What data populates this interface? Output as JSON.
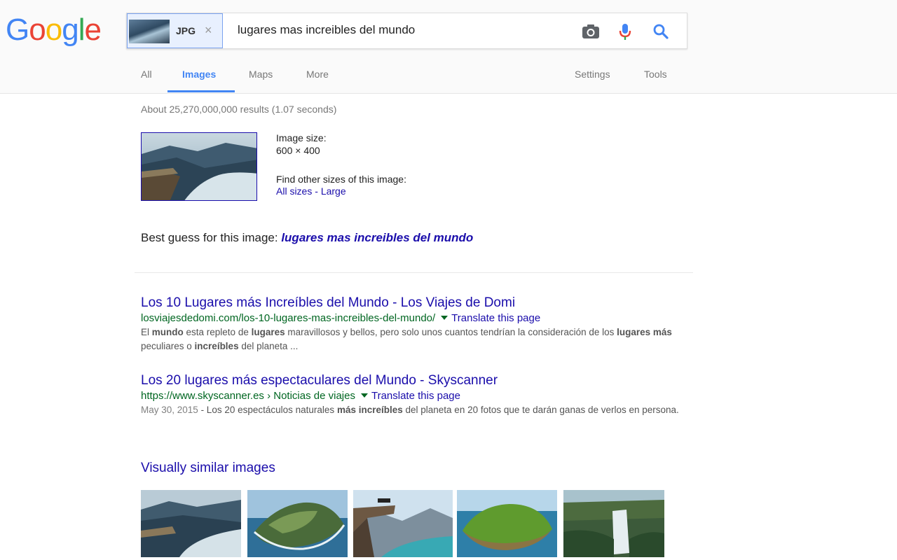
{
  "logo": {
    "text": "Google"
  },
  "search": {
    "chip_label": "JPG",
    "chip_close": "×",
    "query": "lugares mas increibles del mundo"
  },
  "tabs": [
    {
      "label": "All"
    },
    {
      "label": "Images",
      "active": true
    },
    {
      "label": "Maps"
    },
    {
      "label": "More"
    }
  ],
  "tools": [
    {
      "label": "Settings"
    },
    {
      "label": "Tools"
    }
  ],
  "stats": "About 25,270,000,000 results (1.07 seconds)",
  "image_info": {
    "size_label": "Image size:",
    "size_value": "600 × 400",
    "find_label": "Find other sizes of this image:",
    "all_sizes": "All sizes",
    "separator": " - ",
    "large": "Large"
  },
  "best_guess": {
    "label": "Best guess for this image: ",
    "value": "lugares mas increibles del mundo"
  },
  "results": [
    {
      "title": "Los 10 Lugares más Increíbles del Mundo - Los Viajes de Domi",
      "url": "losviajesdedomi.com/los-10-lugares-mas-increibles-del-mundo/",
      "translate": "Translate this page",
      "snippet_parts": [
        {
          "t": "El ",
          "b": false
        },
        {
          "t": "mundo",
          "b": true
        },
        {
          "t": " esta repleto de ",
          "b": false
        },
        {
          "t": "lugares",
          "b": true
        },
        {
          "t": " maravillosos y bellos, pero solo unos cuantos tendrían la consideración de los ",
          "b": false
        },
        {
          "t": "lugares más",
          "b": true
        },
        {
          "t": " peculiares o ",
          "b": false
        },
        {
          "t": "increíbles",
          "b": true
        },
        {
          "t": " del planeta ...",
          "b": false
        }
      ]
    },
    {
      "title": "Los 20 lugares más espectaculares del Mundo - Skyscanner",
      "url": "https://www.skyscanner.es › Noticias de viajes",
      "translate": "Translate this page",
      "date": "May 30, 2015",
      "snippet_parts": [
        {
          "t": " - Los 20 espectáculos naturales ",
          "b": false
        },
        {
          "t": "más increíbles",
          "b": true
        },
        {
          "t": " del planeta en 20 fotos que te darán ganas de verlos en persona.",
          "b": false
        }
      ]
    }
  ],
  "similar": {
    "title": "Visually similar images",
    "images": [
      {
        "name": "fjord-cliff"
      },
      {
        "name": "green-island-coast"
      },
      {
        "name": "rock-ledge-mountains"
      },
      {
        "name": "green-island-sea"
      },
      {
        "name": "waterfall-jungle"
      }
    ]
  },
  "colors": {
    "link": "#1a0dab",
    "url": "#006621",
    "accent": "#4285f4"
  },
  "icons": [
    "camera-icon",
    "microphone-icon",
    "search-icon",
    "close-icon"
  ]
}
